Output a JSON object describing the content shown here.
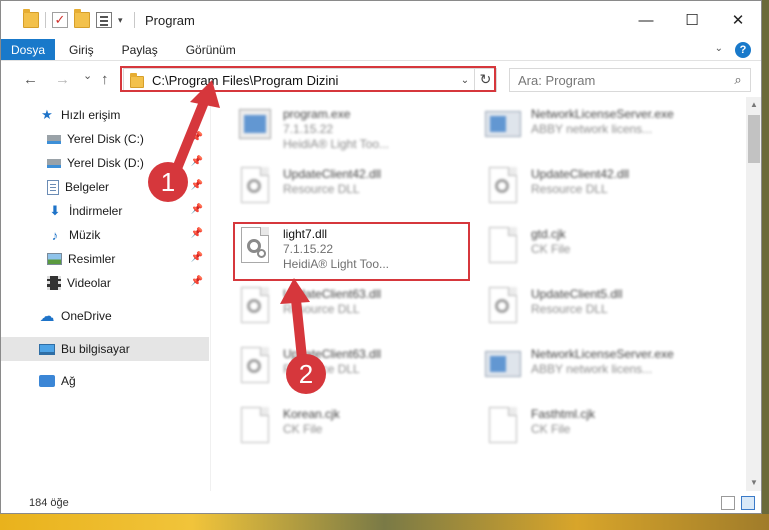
{
  "window": {
    "title": "Program",
    "controls": {
      "minimize": "—",
      "maximize": "☐",
      "close": "✕"
    }
  },
  "ribbon": {
    "tabs": [
      "Dosya",
      "Giriş",
      "Paylaş",
      "Görünüm"
    ],
    "help": "?"
  },
  "nav": {
    "back": "←",
    "forward": "→",
    "history": "⌄",
    "up": "↑",
    "address": "C:\\Program Files\\Program Dizini",
    "refresh": "↻",
    "search_placeholder": "Ara: Program"
  },
  "sidebar": {
    "items": [
      {
        "label": "Hızlı erişim",
        "icon": "star-icon"
      },
      {
        "label": "Yerel Disk (C:)",
        "icon": "disk-icon",
        "pinned": true
      },
      {
        "label": "Yerel Disk (D:)",
        "icon": "disk-icon",
        "pinned": true
      },
      {
        "label": "Belgeler",
        "icon": "documents-icon",
        "pinned": true
      },
      {
        "label": "İndirmeler",
        "icon": "download-icon",
        "pinned": true
      },
      {
        "label": "Müzik",
        "icon": "music-icon",
        "pinned": true
      },
      {
        "label": "Resimler",
        "icon": "pictures-icon",
        "pinned": true
      },
      {
        "label": "Videolar",
        "icon": "video-icon",
        "pinned": true
      },
      {
        "label": "OneDrive",
        "icon": "cloud-icon"
      },
      {
        "label": "Bu bilgisayar",
        "icon": "computer-icon",
        "selected": true
      },
      {
        "label": "Ağ",
        "icon": "network-icon"
      }
    ]
  },
  "files": [
    {
      "name": "program.exe",
      "line2": "7.1.15.22",
      "line3": "HeidiA® Light Too...",
      "icon": "exe-icon"
    },
    {
      "name": "NetworkLicenseServer.exe",
      "line2": "ABBY network licens...",
      "line3": "",
      "icon": "exe-icon"
    },
    {
      "name": "UpdateClient42.dll",
      "line2": "Resource DLL",
      "line3": "",
      "icon": "dll-icon"
    },
    {
      "name": "UpdateClient42.dll",
      "line2": "Resource DLL",
      "line3": "",
      "icon": "dll-icon"
    },
    {
      "name": "light7.dll",
      "line2": "7.1.15.22",
      "line3": "HeidiA® Light Too...",
      "icon": "dll-icon",
      "highlighted": true
    },
    {
      "name": "gtd.cjk",
      "line2": "CK File",
      "line3": "",
      "icon": "file-icon"
    },
    {
      "name": "UpdateClient63.dll",
      "line2": "Resource DLL",
      "line3": "",
      "icon": "dll-icon"
    },
    {
      "name": "UpdateClient5.dll",
      "line2": "Resource DLL",
      "line3": "",
      "icon": "dll-icon"
    },
    {
      "name": "UpdateClient63.dll",
      "line2": "Resource DLL",
      "line3": "",
      "icon": "dll-icon"
    },
    {
      "name": "NetworkLicenseServer.exe",
      "line2": "ABBY network licens...",
      "line3": "",
      "icon": "exe-icon"
    },
    {
      "name": "Korean.cjk",
      "line2": "CK File",
      "line3": "",
      "icon": "file-icon"
    },
    {
      "name": "Fasthtml.cjk",
      "line2": "CK File",
      "line3": "",
      "icon": "file-icon"
    }
  ],
  "annotations": {
    "step1": "1",
    "step2": "2"
  },
  "status": {
    "count": "184 öğe"
  },
  "colors": {
    "accent": "#1979ca",
    "highlight": "#d6373c"
  }
}
